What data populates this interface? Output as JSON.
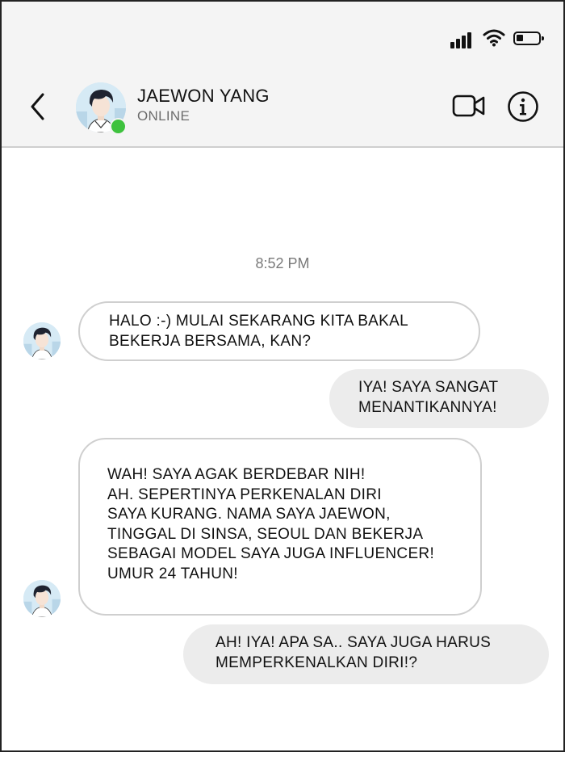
{
  "status_bar": {
    "signal_icon": "signal-bars-icon",
    "wifi_icon": "wifi-icon",
    "battery_icon": "battery-low-icon",
    "battery_level": 0.25
  },
  "header": {
    "back_icon": "chevron-left-icon",
    "contact_name": "JAEWON YANG",
    "contact_status": "ONLINE",
    "online_indicator_color": "#3ec23e",
    "video_call_icon": "video-camera-icon",
    "info_icon": "info-icon"
  },
  "chat": {
    "timestamp": "8:52 PM",
    "messages": [
      {
        "sender": "contact",
        "lines": [
          "HALO :-) MULAI SEKARANG KITA BAKAL",
          "BEKERJA BERSAMA, KAN?"
        ]
      },
      {
        "sender": "me",
        "lines": [
          "IYA! SAYA SANGAT",
          "MENANTIKANNYA!"
        ]
      },
      {
        "sender": "contact",
        "lines": [
          "WAH! SAYA AGAK BERDEBAR NIH!",
          "AH. SEPERTINYA PERKENALAN DIRI",
          "SAYA KURANG. NAMA SAYA JAEWON,",
          "TINGGAL DI SINSA, SEOUL DAN BEKERJA",
          "SEBAGAI MODEL SAYA JUGA INFLUENCER!",
          "UMUR 24 TAHUN!"
        ]
      },
      {
        "sender": "me",
        "lines": [
          "AH! IYA! APA SA.. SAYA JUGA HARUS",
          "MEMPERKENALKAN DIRI!?"
        ]
      }
    ]
  },
  "colors": {
    "header_bg": "#f4f4f4",
    "outgoing_bubble": "#ececec",
    "incoming_border": "#cfcfcf"
  }
}
